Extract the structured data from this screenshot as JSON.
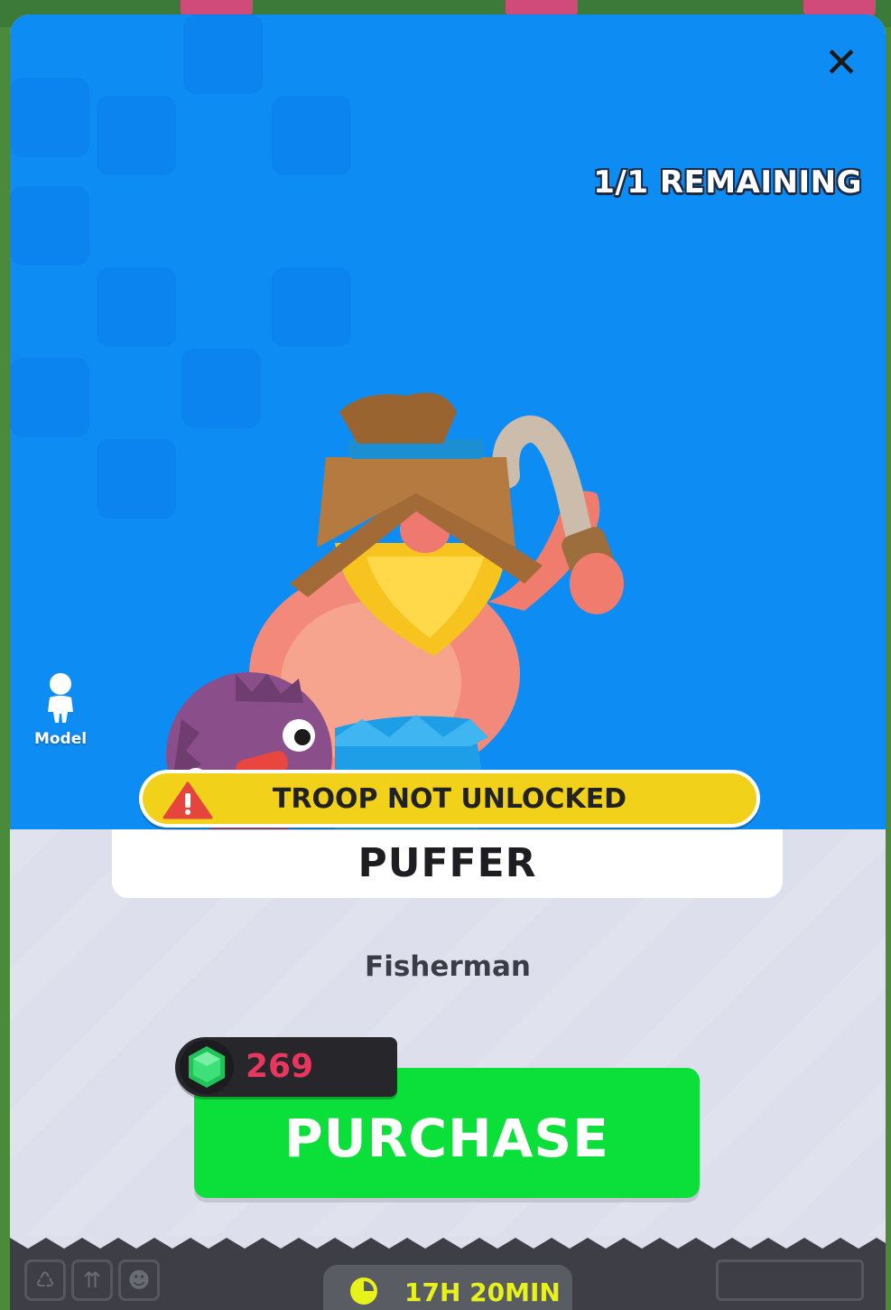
{
  "offer": {
    "remaining": "1/1 REMAINING",
    "model_label": "Model",
    "status_warning": "TROOP NOT UNLOCKED",
    "troop_name": "PUFFER",
    "troop_class": "Fisherman"
  },
  "price": {
    "amount": "269",
    "currency_icon": "gem-icon"
  },
  "actions": {
    "close": "✕",
    "purchase_label": "PURCHASE"
  },
  "timer": {
    "icon": "clock-icon",
    "text": "17H 20MIN"
  },
  "colors": {
    "header_bg": "#0d8cf4",
    "warning_bg": "#f1d11a",
    "purchase_bg": "#0be03a",
    "price_text": "#e8365e",
    "timer_text": "#e7f21a"
  }
}
